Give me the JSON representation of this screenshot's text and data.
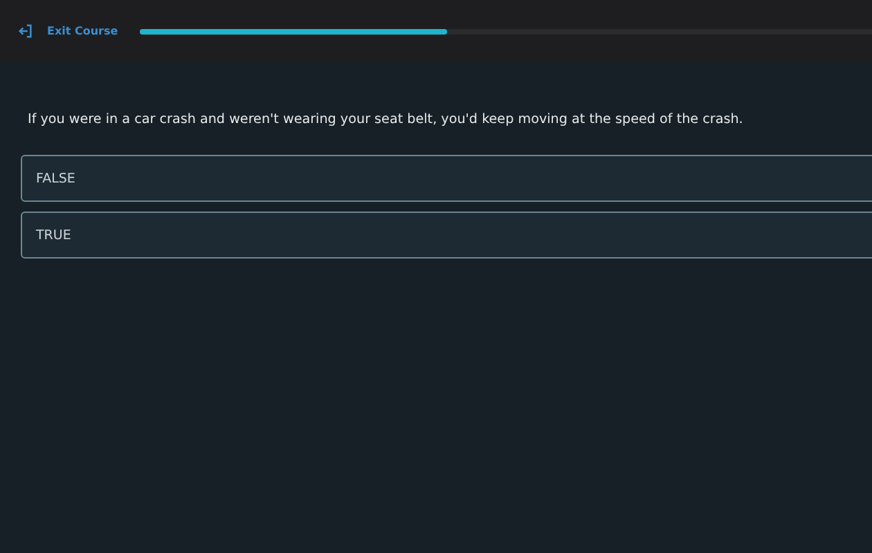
{
  "header": {
    "exit_label": "Exit Course",
    "progress": {
      "level": 0.42
    }
  },
  "question": "If you were in a car crash and weren't wearing your seat belt, you'd keep moving at the speed of the crash.",
  "options": [
    {
      "label": "FALSE"
    },
    {
      "label": "TRUE"
    }
  ]
}
